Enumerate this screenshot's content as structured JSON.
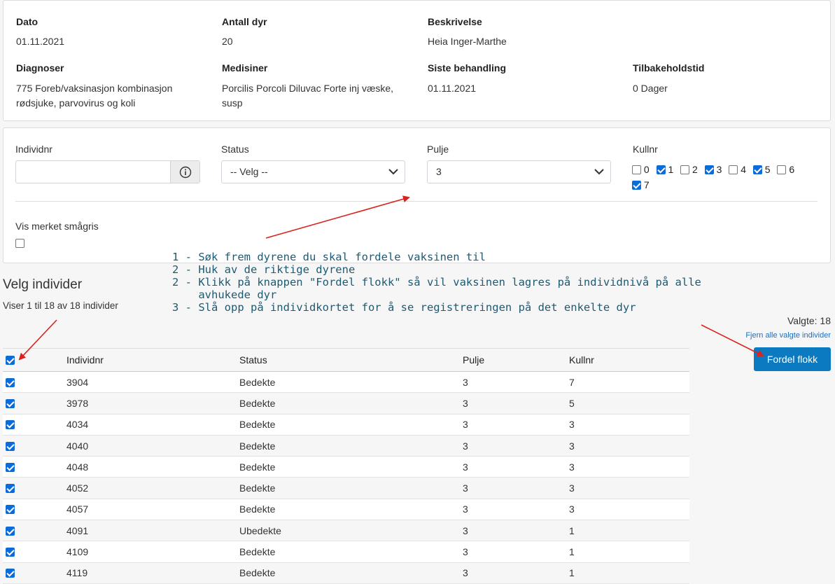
{
  "summary": {
    "dato_label": "Dato",
    "dato_value": "01.11.2021",
    "antall_label": "Antall dyr",
    "antall_value": "20",
    "beskrivelse_label": "Beskrivelse",
    "beskrivelse_value": "Heia Inger-Marthe",
    "diagnoser_label": "Diagnoser",
    "diagnoser_line1": "775 Foreb/vaksinasjon kombinasjon",
    "diagnoser_line2": "rødsjuke, parvovirus og koli",
    "medisiner_label": "Medisiner",
    "medisiner_line1": "Porcilis Porcoli Diluvac Forte inj væske,",
    "medisiner_line2": "susp",
    "siste_label": "Siste behandling",
    "siste_value": "01.11.2021",
    "tilbake_label": "Tilbakeholdstid",
    "tilbake_value": "0 Dager"
  },
  "filters": {
    "individnr_label": "Individnr",
    "individnr_value": "",
    "status_label": "Status",
    "status_value": "-- Velg --",
    "pulje_label": "Pulje",
    "pulje_value": "3",
    "kullnr_label": "Kullnr",
    "kullnr_options": [
      {
        "label": "0",
        "checked": false
      },
      {
        "label": "1",
        "checked": true
      },
      {
        "label": "2",
        "checked": false
      },
      {
        "label": "3",
        "checked": true
      },
      {
        "label": "4",
        "checked": false
      },
      {
        "label": "5",
        "checked": true
      },
      {
        "label": "6",
        "checked": false
      },
      {
        "label": "7",
        "checked": true
      }
    ],
    "vis_merket_label": "Vis merket smågris"
  },
  "instructions": [
    "1 - Søk frem dyrene du skal fordele vaksinen til",
    "2 - Huk av de riktige dyrene",
    "2 - Klikk på knappen \"Fordel flokk\" så vil vaksinen lagres på individnivå på alle",
    "    avhukede dyr",
    "3 - Slå opp på individkortet for å se registreringen på det enkelte dyr"
  ],
  "list": {
    "title": "Velg individer",
    "subtitle": "Viser 1 til 18 av 18 individer",
    "valgte": "Valgte: 18",
    "fjern": "Fjern alle valgte individer",
    "fordel_button": "Fordel flokk",
    "columns": [
      "Individnr",
      "Status",
      "Pulje",
      "Kullnr"
    ],
    "rows": [
      {
        "individnr": "3904",
        "status": "Bedekte",
        "pulje": "3",
        "kullnr": "7"
      },
      {
        "individnr": "3978",
        "status": "Bedekte",
        "pulje": "3",
        "kullnr": "5"
      },
      {
        "individnr": "4034",
        "status": "Bedekte",
        "pulje": "3",
        "kullnr": "3"
      },
      {
        "individnr": "4040",
        "status": "Bedekte",
        "pulje": "3",
        "kullnr": "3"
      },
      {
        "individnr": "4048",
        "status": "Bedekte",
        "pulje": "3",
        "kullnr": "3"
      },
      {
        "individnr": "4052",
        "status": "Bedekte",
        "pulje": "3",
        "kullnr": "3"
      },
      {
        "individnr": "4057",
        "status": "Bedekte",
        "pulje": "3",
        "kullnr": "3"
      },
      {
        "individnr": "4091",
        "status": "Ubedekte",
        "pulje": "3",
        "kullnr": "1"
      },
      {
        "individnr": "4109",
        "status": "Bedekte",
        "pulje": "3",
        "kullnr": "1"
      },
      {
        "individnr": "4119",
        "status": "Bedekte",
        "pulje": "3",
        "kullnr": "1"
      }
    ]
  },
  "colors": {
    "accent": "#0b7ac0",
    "checkbox": "#0b6bd8",
    "annotation_text": "#1d5a73",
    "annotation_arrow": "#d9231d"
  }
}
